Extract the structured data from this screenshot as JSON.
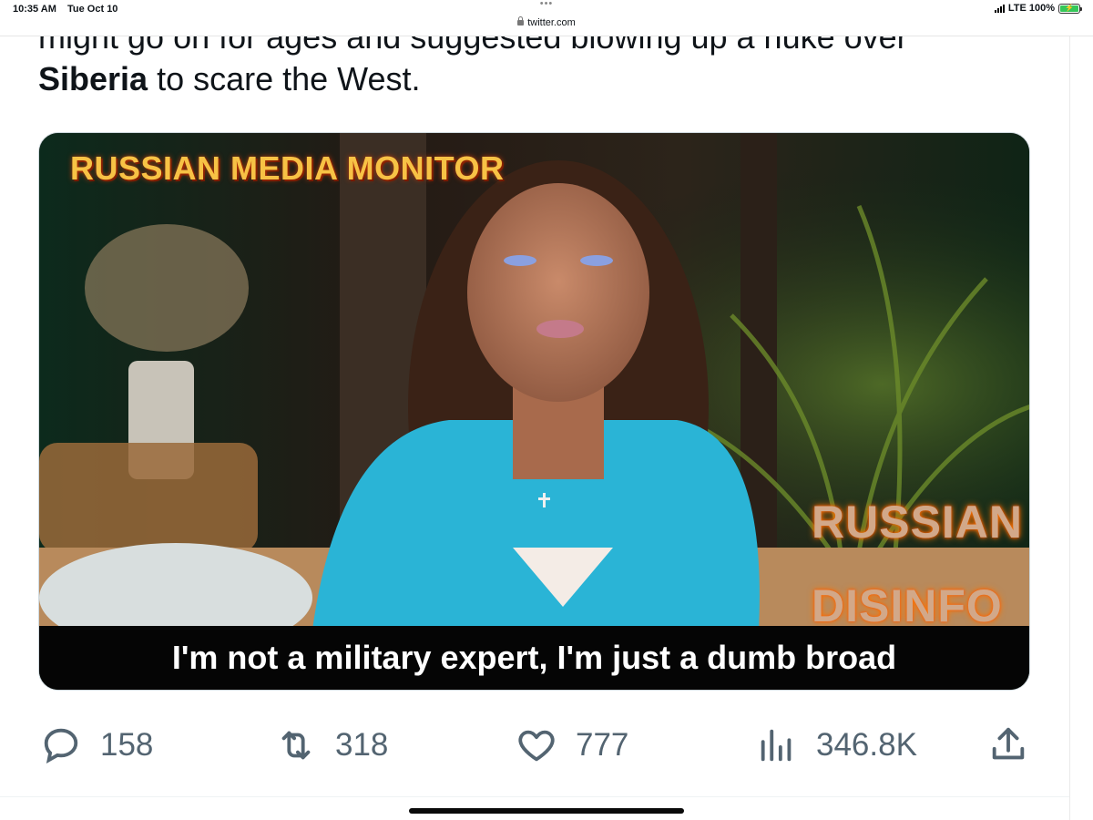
{
  "status": {
    "time": "10:35 AM",
    "date": "Tue Oct 10",
    "dots": "•••",
    "url": "twitter.com",
    "network": "LTE 100%",
    "battery_level": 1.0
  },
  "tweet": {
    "line1": "might go on for ages and suggested blowing up a nuke over",
    "line2_bold": "Siberia",
    "line2_rest": " to scare the West."
  },
  "media": {
    "title": "RUSSIAN MEDIA MONITOR",
    "watermark_line1": "RUSSIAN",
    "watermark_line2": "DISINFO",
    "subtitle": "I'm not a military expert, I'm just a dumb broad"
  },
  "actions": {
    "replies": "158",
    "retweets": "318",
    "likes": "777",
    "views": "346.8K",
    "reply_icon": "reply-icon",
    "retweet_icon": "retweet-icon",
    "like_icon": "heart-icon",
    "views_icon": "views-icon",
    "share_icon": "share-icon"
  },
  "colors": {
    "icon": "#536471",
    "title_orange": "#f7c245",
    "shirt": "#2ab4d6",
    "battery": "#34c759"
  }
}
